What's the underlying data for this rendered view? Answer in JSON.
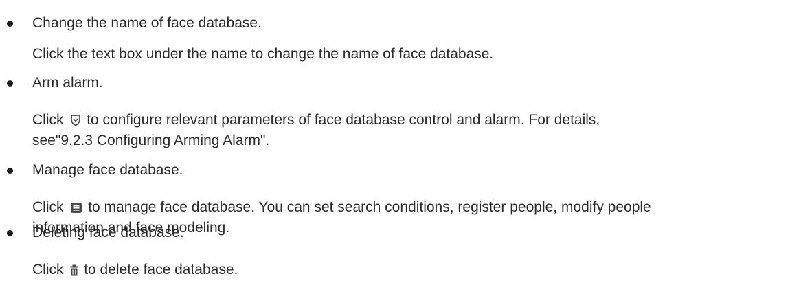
{
  "items": [
    {
      "title": "Change the name of face database.",
      "desc": "Click the text box under the name to change the name of face database."
    },
    {
      "title": "Arm alarm.",
      "desc_prefix": "Click",
      "icon": "shield-icon",
      "desc_suffix": "to configure relevant parameters of face database control and alarm. For details,",
      "desc_line2": "see\"9.2.3 Configuring Arming Alarm\"."
    },
    {
      "title": "Manage face database.",
      "desc_prefix": "Click",
      "icon": "list-icon",
      "desc_suffix": "to manage face database. You can set search conditions, register people, modify people",
      "desc_line2": "information and face modeling."
    },
    {
      "title": "Deleting face database.",
      "desc_prefix": "Click",
      "icon": "trash-icon",
      "desc_suffix": "to delete face database."
    }
  ]
}
